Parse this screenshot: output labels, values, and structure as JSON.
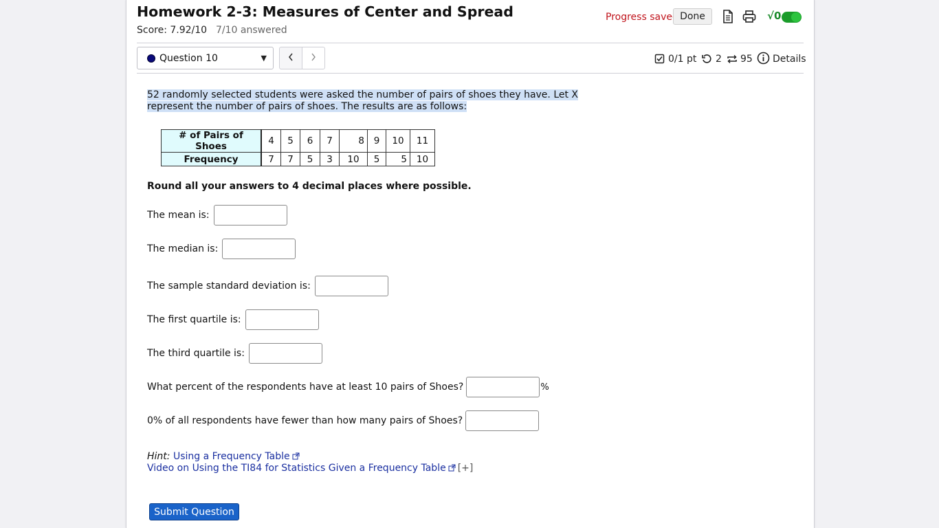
{
  "header": {
    "title": "Homework 2-3: Measures of Center and Spread",
    "score": "Score: 7.92/10",
    "answered": "7/10 answered",
    "progress_saved": "Progress saved",
    "done_label": "Done",
    "math_label": "√0"
  },
  "toolbar": {
    "question_select": "Question 10",
    "points": "0/1 pt",
    "retries": "2",
    "attempts": "95",
    "details_label": "Details"
  },
  "question": {
    "text": "52 randomly selected students were asked the number of pairs of shoes they have. Let X represent the number of pairs of shoes. The results are as follows:",
    "table": {
      "row1_header": "# of Pairs of Shoes",
      "row2_header": "Frequency",
      "x_values": [
        "4",
        "5",
        "6",
        "7",
        "8",
        "9",
        "10",
        "11"
      ],
      "frequencies": [
        "7",
        "7",
        "5",
        "3",
        "10",
        "5",
        "5",
        "10"
      ]
    },
    "instructions": "Round all your answers to 4 decimal places where possible.",
    "prompts": {
      "mean": "The mean is:",
      "median": "The median is:",
      "sd": "The sample standard deviation is:",
      "q1": "The first quartile is:",
      "q3": "The third quartile is:",
      "percent": "What percent of the respondents have at least 10 pairs of Shoes?",
      "percent_suffix": "%",
      "fewer": "0% of all respondents have fewer than how many pairs of Shoes?"
    },
    "answers": {
      "mean": "",
      "median": "",
      "sd": "",
      "q1": "",
      "q3": "",
      "percent": "",
      "fewer": ""
    }
  },
  "hints": {
    "label": "Hint:",
    "link1": "Using a Frequency Table",
    "link2": "Video on Using the TI84 for Statistics Given a Frequency Table",
    "expand": "[+]"
  },
  "submit_label": "Submit Question",
  "colors": {
    "accent": "#1a63c9",
    "progress_red": "#c0141c",
    "toggle_green": "#1a9c2a",
    "table_header_bg": "#e0fbfd",
    "selection_highlight": "#cfe0f6"
  }
}
